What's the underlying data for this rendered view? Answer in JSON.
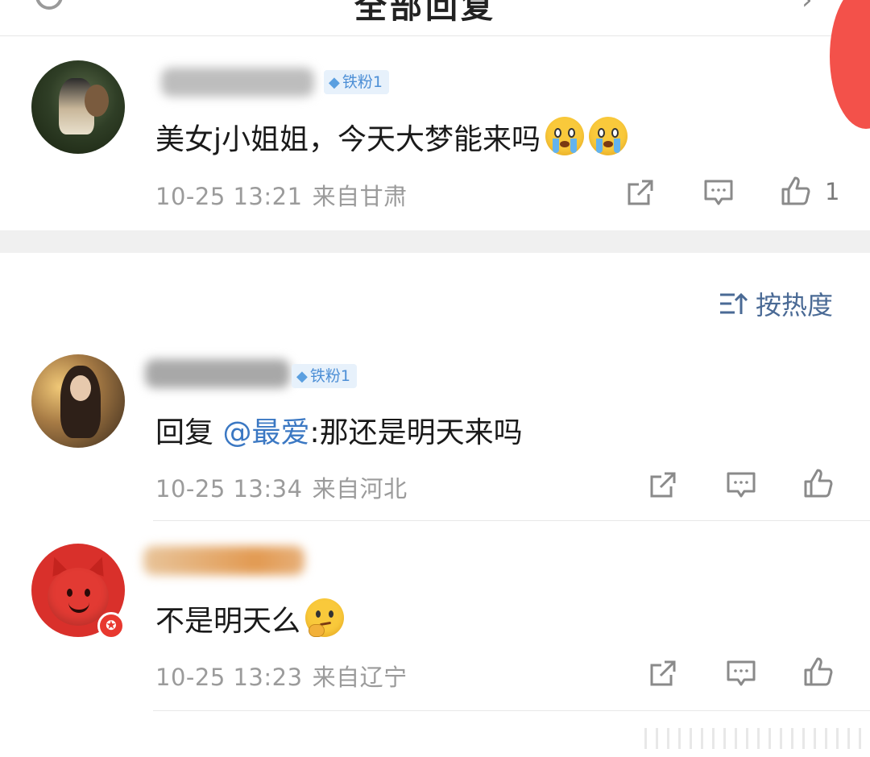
{
  "header": {
    "title": "全部回复"
  },
  "sort": {
    "label": "按热度"
  },
  "comments": [
    {
      "rank": "铁粉1",
      "content": "美女j小姐姐，今天大梦能来吗",
      "time": "10-25 13:21",
      "location": "来自甘肃",
      "likes": "1",
      "emoji": "crying-emoji",
      "avatar_icon": "photo-avatar"
    },
    {
      "rank": "铁粉1",
      "reply_prefix": "回复",
      "mention": "@最爱",
      "content": ":那还是明天来吗",
      "time": "10-25 13:34",
      "location": "来自河北",
      "avatar_icon": "photo-avatar"
    },
    {
      "content": "不是明天么",
      "time": "10-25 13:23",
      "location": "来自辽宁",
      "emoji": "thinking-emoji",
      "avatar_icon": "red-devil-avatar",
      "badge_icon": "verified-star-icon"
    }
  ],
  "colors": {
    "accent_link": "#3b78c3",
    "meta_text": "#9b9b9b",
    "badge_bg": "#e7f1fb",
    "badge_text": "#4d8fd6",
    "section_gap": "#f0f0f0"
  }
}
